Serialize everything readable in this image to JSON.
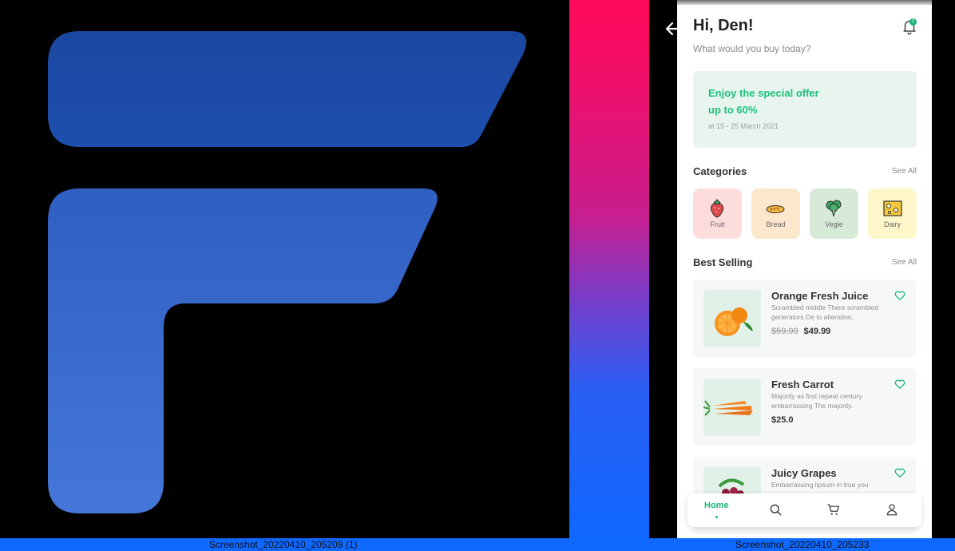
{
  "left_pane": {
    "logo": "app-logo-F",
    "logo_color_top": "#1a47a0",
    "logo_color_bottom": "#3f74d6"
  },
  "right_pane": {
    "header": {
      "greeting": "Hi, Den!",
      "subtitle": "What would you buy today?",
      "notification_count": "2"
    },
    "offer": {
      "line1": "Enjoy the special offer",
      "line2": "up to 60%",
      "date": "at 15 - 25 March 2021"
    },
    "categories": {
      "title": "Categories",
      "see_all": "See All",
      "items": [
        {
          "label": "Fruit",
          "icon": "strawberry-icon",
          "bg": "#fddcdc"
        },
        {
          "label": "Bread",
          "icon": "bread-icon",
          "bg": "#fde7cc"
        },
        {
          "label": "Vegie",
          "icon": "broccoli-icon",
          "bg": "#d7ead8"
        },
        {
          "label": "Dairy",
          "icon": "cheese-icon",
          "bg": "#fdf7c9"
        }
      ]
    },
    "best_selling": {
      "title": "Best Selling",
      "see_all": "See All",
      "products": [
        {
          "name": "Orange Fresh Juice",
          "desc": "Scrambled middle There scrambled generators De to alteration.",
          "old_price": "$59.99",
          "price": "$49.99"
        },
        {
          "name": "Fresh Carrot",
          "desc": "Majority as first repeat century embarrassing The majority.",
          "price": "$25.0"
        },
        {
          "name": "Juicy Grapes",
          "desc": "Embarrassing lipsum in true you"
        }
      ]
    },
    "nav": {
      "home_label": "Home",
      "items": [
        "home",
        "search-icon",
        "cart-icon",
        "profile-icon"
      ]
    },
    "accent": "#17b874"
  },
  "taskbar": {
    "left_caption": "Screenshot_20220410_205209 (1)",
    "right_caption": "Screenshot_20220410_205233"
  }
}
